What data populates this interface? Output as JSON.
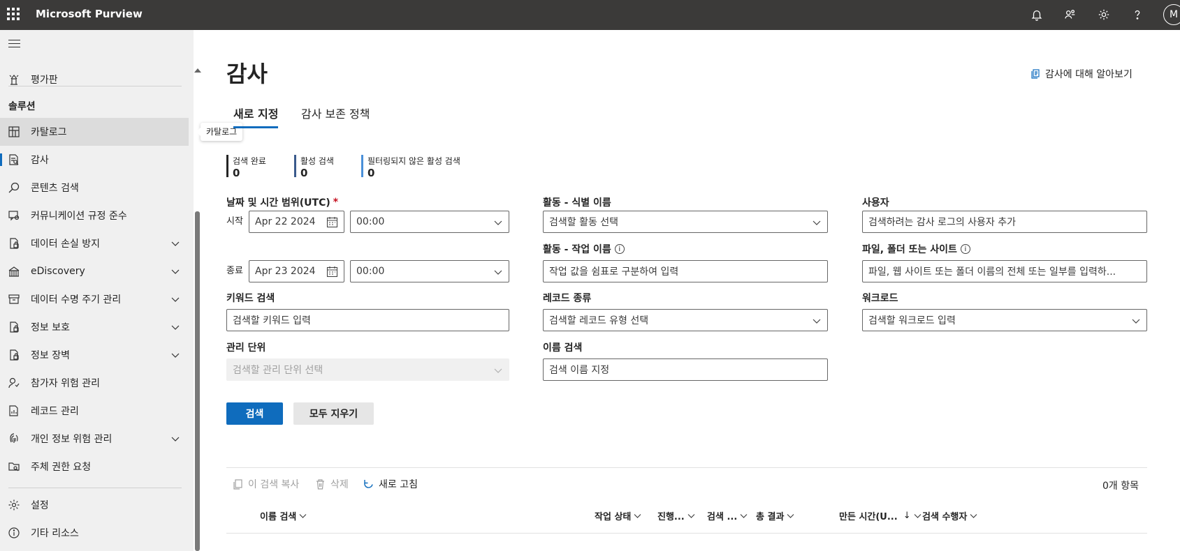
{
  "app": {
    "brand": "Microsoft Purview",
    "avatar_initial": "M",
    "icons": [
      "notifications-icon",
      "contact-icon",
      "settings-icon",
      "help-icon"
    ]
  },
  "sidebar": {
    "top_item": "평가판",
    "section": "솔루션",
    "items": [
      {
        "label": "카탈로그",
        "icon": "catalog-icon",
        "expandable": false
      },
      {
        "label": "감사",
        "icon": "audit-icon",
        "expandable": false
      },
      {
        "label": "콘텐츠 검색",
        "icon": "search-icon",
        "expandable": false
      },
      {
        "label": "커뮤니케이션 규정 준수",
        "icon": "communication-icon",
        "expandable": false
      },
      {
        "label": "데이터 손실 방지",
        "icon": "dlp-icon",
        "expandable": true
      },
      {
        "label": "eDiscovery",
        "icon": "ediscovery-icon",
        "expandable": true
      },
      {
        "label": "데이터 수명 주기 관리",
        "icon": "lifecycle-icon",
        "expandable": true
      },
      {
        "label": "정보 보호",
        "icon": "protection-icon",
        "expandable": true
      },
      {
        "label": "정보 장벽",
        "icon": "barrier-icon",
        "expandable": true
      },
      {
        "label": "참가자 위험 관리",
        "icon": "insider-risk-icon",
        "expandable": false
      },
      {
        "label": "레코드 관리",
        "icon": "records-icon",
        "expandable": false
      },
      {
        "label": "개인 정보 위험 관리",
        "icon": "privacy-icon",
        "expandable": true
      },
      {
        "label": "주체 권한 요청",
        "icon": "subject-rights-icon",
        "expandable": false
      }
    ],
    "settings": "설정",
    "other": "기타 리소스",
    "tooltip": "카탈로그"
  },
  "page": {
    "title": "감사",
    "learn_link": "감사에 대해 알아보기",
    "tabs": [
      "새로 지정",
      "감사 보존 정책"
    ],
    "stats": [
      {
        "label": "검색 완료",
        "value": "0",
        "color": "#242424"
      },
      {
        "label": "활성 검색",
        "value": "0",
        "color": "#3a5a8c"
      },
      {
        "label": "필터링되지 않은 활성 검색",
        "value": "0",
        "color": "#4a90d9"
      }
    ]
  },
  "form": {
    "date_label": "날짜 및 시간 범위(UTC)",
    "required_mark": "*",
    "start_label": "시작",
    "end_label": "종료",
    "start_date": "Apr 22 2024",
    "start_time": "00:00",
    "end_date": "Apr 23 2024",
    "end_time": "00:00",
    "keyword_label": "키워드 검색",
    "keyword_placeholder": "검색할 키워드 입력",
    "admin_unit_label": "관리 단위",
    "admin_unit_placeholder": "검색할 관리 단위 선택",
    "activity_friendly_label": "활동 - 식별 이름",
    "activity_friendly_placeholder": "검색할 활동 선택",
    "activity_op_label": "활동 - 작업 이름",
    "activity_op_placeholder": "작업 값을 쉼표로 구분하여 입력",
    "record_type_label": "레코드 종류",
    "record_type_placeholder": "검색할 레코드 유형 선택",
    "search_name_label": "이름 검색",
    "search_name_placeholder": "검색 이름 지정",
    "users_label": "사용자",
    "users_placeholder": "검색하려는 감사 로그의 사용자 추가",
    "file_label": "파일, 폴더 또는 사이트",
    "file_placeholder": "파일, 웹 사이트 또는 폴더 이름의 전체 또는 일부를 입력하...",
    "workload_label": "워크로드",
    "workload_placeholder": "검색할 워크로드 입력",
    "info_glyph": "i"
  },
  "actions": {
    "search": "검색",
    "clear_all": "모두 지우기"
  },
  "toolbar": {
    "copy": "이 검색 복사",
    "delete": "삭제",
    "refresh": "새로 고침",
    "count": "0개 항목"
  },
  "table": {
    "columns": [
      "이름 검색",
      "작업 상태",
      "진행...",
      "검색 ...",
      "총 결과",
      "만든 시간(U...",
      "검색 수행자"
    ],
    "sort_arrow": "↓"
  }
}
